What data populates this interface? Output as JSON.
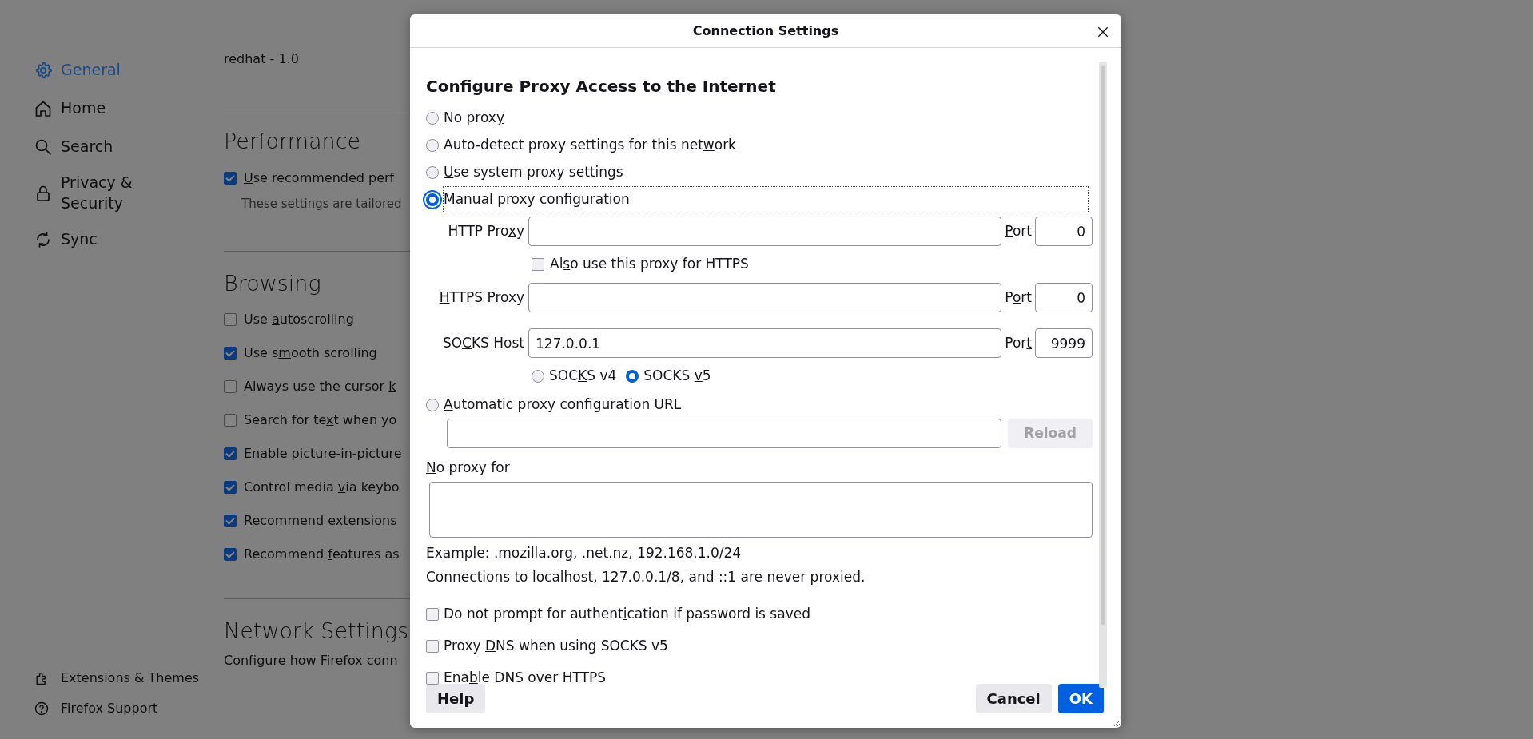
{
  "sidebar": {
    "items": [
      {
        "label": "General",
        "selected": true
      },
      {
        "label": "Home",
        "selected": false
      },
      {
        "label": "Search",
        "selected": false
      },
      {
        "label": "Privacy & Security",
        "selected": false
      },
      {
        "label": "Sync",
        "selected": false
      }
    ],
    "footer_links": [
      {
        "label": "Extensions & Themes"
      },
      {
        "label": "Firefox Support"
      }
    ]
  },
  "content": {
    "version_text": "redhat - 1.0",
    "sections": [
      {
        "title": "Performance",
        "items": [
          {
            "kind": "checkbox",
            "checked": true,
            "label": {
              "key": "U",
              "post": "se recommended perf"
            }
          },
          {
            "kind": "note",
            "text": "These settings are tailored"
          }
        ]
      },
      {
        "title": "Browsing",
        "items": [
          {
            "kind": "checkbox",
            "checked": false,
            "label": {
              "pre": "Use ",
              "key": "a",
              "post": "utoscrolling"
            }
          },
          {
            "kind": "checkbox",
            "checked": true,
            "label": {
              "pre": "Use s",
              "key": "m",
              "post": "ooth scrolling"
            }
          },
          {
            "kind": "checkbox",
            "checked": false,
            "label": {
              "pre": "Always use the cursor ",
              "key": "k"
            }
          },
          {
            "kind": "checkbox",
            "checked": false,
            "label": {
              "pre": "Search for te",
              "key": "x",
              "post": "t when yo"
            }
          },
          {
            "kind": "checkbox",
            "checked": true,
            "label": {
              "key": "E",
              "post": "nable picture-in-picture"
            }
          },
          {
            "kind": "checkbox",
            "checked": true,
            "label": {
              "pre": "Control media ",
              "key": "v",
              "post": "ia keybo"
            }
          },
          {
            "kind": "checkbox",
            "checked": true,
            "label": {
              "key": "R",
              "post": "ecommend extensions"
            }
          },
          {
            "kind": "checkbox",
            "checked": true,
            "label": {
              "pre": "Recommend ",
              "key": "f",
              "post": "eatures as"
            }
          }
        ]
      },
      {
        "title": "Network Settings",
        "items": [
          {
            "kind": "note",
            "text": "Configure how Firefox conn"
          }
        ]
      }
    ]
  },
  "dialog": {
    "title": "Connection Settings",
    "heading": "Configure Proxy Access to the Internet",
    "modes": [
      {
        "kind": "plain",
        "selected": false,
        "focused": false,
        "label": {
          "pre": "No prox",
          "key": "y"
        }
      },
      {
        "kind": "plain",
        "selected": false,
        "focused": false,
        "label": {
          "pre": "Auto-detect proxy settings for this net",
          "key": "w",
          "post": "ork"
        }
      },
      {
        "kind": "plain",
        "selected": false,
        "focused": false,
        "label": {
          "key": "U",
          "post": "se system proxy settings"
        }
      },
      {
        "kind": "manual",
        "selected": true,
        "focused": true,
        "label": {
          "key": "M",
          "post": "anual proxy configuration"
        }
      },
      {
        "kind": "url",
        "selected": false,
        "focused": false,
        "label": {
          "key": "A",
          "post": "utomatic proxy configuration URL"
        }
      }
    ],
    "manual": {
      "http": {
        "label": {
          "pre": "HTTP Pro",
          "key": "x",
          "post": "y"
        },
        "port_label": {
          "key": "P",
          "post": "ort"
        },
        "port": "0"
      },
      "also_https": {
        "checked": false,
        "label": {
          "pre": "Al",
          "key": "s",
          "post": "o use this proxy for HTTPS"
        }
      },
      "https": {
        "label": {
          "key": "H",
          "post": "TTPS Proxy"
        },
        "port_label": {
          "pre": "P",
          "key": "o",
          "post": "rt"
        },
        "port": "0"
      },
      "socks": {
        "label": {
          "pre": "SO",
          "key": "C",
          "post": "KS Host"
        },
        "value": "127.0.0.1",
        "port_label": {
          "pre": "Por",
          "key": "t"
        },
        "port": "9999"
      },
      "socks_versions": [
        {
          "selected": false,
          "label": {
            "pre": "SOC",
            "key": "K",
            "post": "S v4"
          }
        },
        {
          "selected": true,
          "label": {
            "pre": "SOCKS ",
            "key": "v",
            "post": "5"
          }
        }
      ]
    },
    "reload": {
      "disabled": true,
      "label": {
        "pre": "R",
        "key": "e",
        "post": "load"
      }
    },
    "no_proxy": {
      "label": {
        "key": "N",
        "post": "o proxy for"
      },
      "example": "Example: .mozilla.org, .net.nz, 192.168.1.0/24",
      "note": "Connections to localhost, 127.0.0.1/8, and ::1 are never proxied."
    },
    "checkboxes": [
      {
        "checked": false,
        "label": {
          "pre": "Do not prompt for authent",
          "key": "i",
          "post": "cation if password is saved"
        }
      },
      {
        "checked": false,
        "label": {
          "pre": "Proxy ",
          "key": "D",
          "post": "NS when using SOCKS v5"
        }
      },
      {
        "checked": false,
        "label": {
          "pre": "Ena",
          "key": "b",
          "post": "le DNS over HTTPS"
        }
      }
    ],
    "buttons": [
      {
        "kind": "help",
        "label": {
          "key": "H",
          "post": "elp"
        }
      },
      {
        "kind": "cancel",
        "label": {
          "pre": "Cancel"
        }
      },
      {
        "kind": "ok",
        "label": {
          "pre": "OK"
        }
      }
    ]
  }
}
